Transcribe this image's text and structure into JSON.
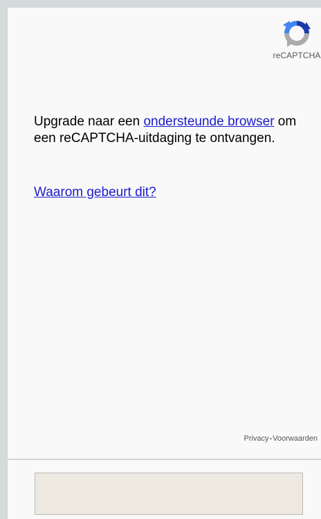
{
  "logo": {
    "icon": "recaptcha-logo-icon",
    "label": "reCAPTCHA"
  },
  "message": {
    "prefix": "Upgrade naar een ",
    "link_text": "ondersteunde browser",
    "suffix": " om een reCAPTCHA-uitdaging te ontvangen."
  },
  "why_link": "Waarom gebeurt dit?",
  "footer": {
    "privacy": "Privacy",
    "separator": "-",
    "terms": "Voorwaarden"
  },
  "colors": {
    "link": "#1c1ccc",
    "background": "#f9f9f9",
    "outer": "#d5dadb",
    "input_box": "#ede9e1"
  }
}
